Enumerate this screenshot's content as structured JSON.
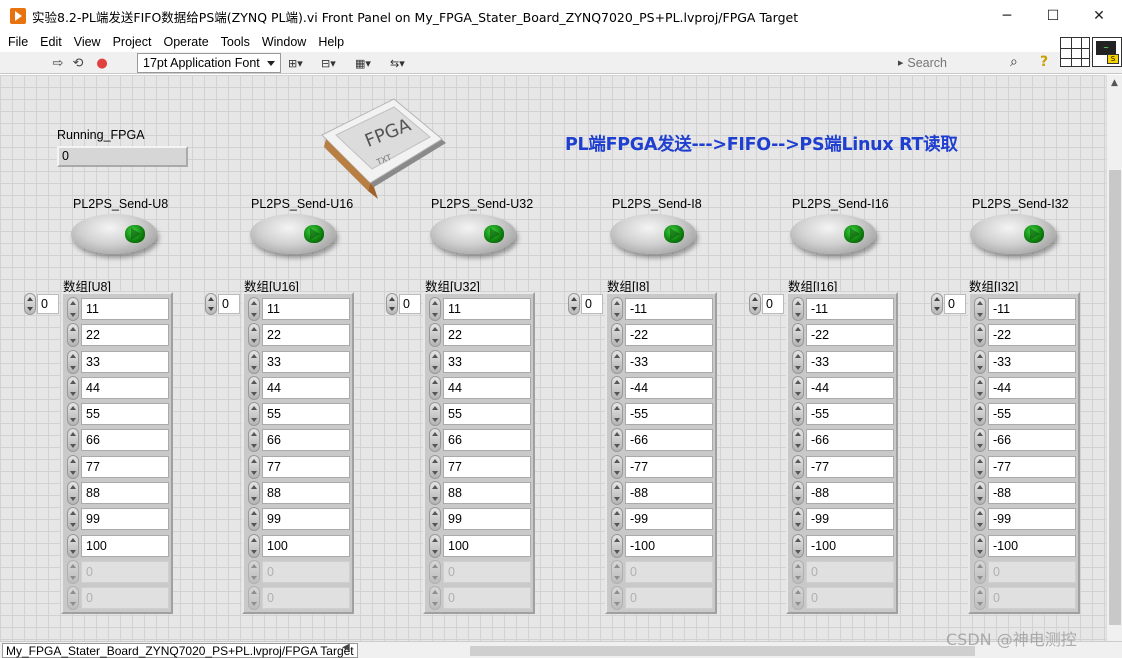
{
  "window": {
    "title": "实验8.2-PL端发送FIFO数据给PS端(ZYNQ PL端).vi Front Panel on My_FPGA_Stater_Board_ZYNQ7020_PS+PL.lvproj/FPGA Target",
    "minimize": "─",
    "maximize": "☐",
    "close": "✕"
  },
  "menu": [
    "File",
    "Edit",
    "View",
    "Project",
    "Operate",
    "Tools",
    "Window",
    "Help"
  ],
  "toolbar": {
    "font": "17pt Application Font",
    "search_placeholder": "Search",
    "help": "?"
  },
  "panel": {
    "running_label": "Running_FPGA",
    "running_value": "0",
    "headline": "PL端FPGA发送--->FIFO-->PS端Linux RT读取",
    "chip_text": "FPGA",
    "chip_sub": "TXT"
  },
  "channels": [
    {
      "button": "PL2PS_Send-U8",
      "array": "数组[U8]",
      "index": "0",
      "values": [
        "11",
        "22",
        "33",
        "44",
        "55",
        "66",
        "77",
        "88",
        "99",
        "100",
        "0",
        "0"
      ]
    },
    {
      "button": "PL2PS_Send-U16",
      "array": "数组[U16]",
      "index": "0",
      "values": [
        "11",
        "22",
        "33",
        "44",
        "55",
        "66",
        "77",
        "88",
        "99",
        "100",
        "0",
        "0"
      ]
    },
    {
      "button": "PL2PS_Send-U32",
      "array": "数组[U32]",
      "index": "0",
      "values": [
        "11",
        "22",
        "33",
        "44",
        "55",
        "66",
        "77",
        "88",
        "99",
        "100",
        "0",
        "0"
      ]
    },
    {
      "button": "PL2PS_Send-I8",
      "array": "数组[I8]",
      "index": "0",
      "values": [
        "-11",
        "-22",
        "-33",
        "-44",
        "-55",
        "-66",
        "-77",
        "-88",
        "-99",
        "-100",
        "0",
        "0"
      ]
    },
    {
      "button": "PL2PS_Send-I16",
      "array": "数组[I16]",
      "index": "0",
      "values": [
        "-11",
        "-22",
        "-33",
        "-44",
        "-55",
        "-66",
        "-77",
        "-88",
        "-99",
        "-100",
        "0",
        "0"
      ]
    },
    {
      "button": "PL2PS_Send-I32",
      "array": "数组[I32]",
      "index": "0",
      "values": [
        "-11",
        "-22",
        "-33",
        "-44",
        "-55",
        "-66",
        "-77",
        "-88",
        "-99",
        "-100",
        "0",
        "0"
      ]
    }
  ],
  "status": {
    "target": "My_FPGA_Stater_Board_ZYNQ7020_PS+PL.lvproj/FPGA Target",
    "watermark": "CSDN @神电测控"
  }
}
